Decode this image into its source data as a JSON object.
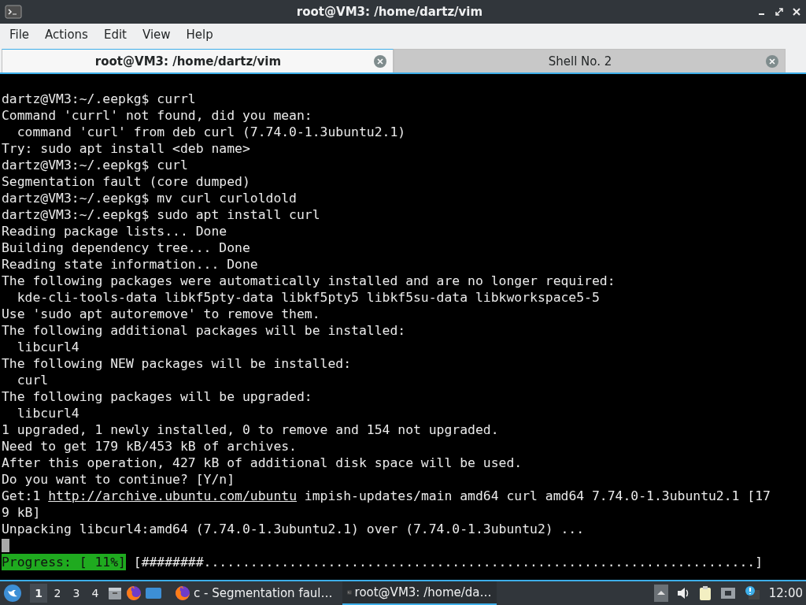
{
  "window": {
    "title": "root@VM3: /home/dartz/vim"
  },
  "menu": [
    "File",
    "Actions",
    "Edit",
    "View",
    "Help"
  ],
  "tabs": [
    {
      "label": "root@VM3: /home/dartz/vim",
      "selected": true
    },
    {
      "label": "Shell No. 2",
      "selected": false
    }
  ],
  "terminal": {
    "lines": [
      {
        "kind": "blank"
      },
      {
        "kind": "text",
        "text": "dartz@VM3:~/.eepkg$ currl"
      },
      {
        "kind": "text",
        "text": "Command 'currl' not found, did you mean:"
      },
      {
        "kind": "text",
        "text": "  command 'curl' from deb curl (7.74.0-1.3ubuntu2.1)"
      },
      {
        "kind": "text",
        "text": "Try: sudo apt install <deb name>"
      },
      {
        "kind": "text",
        "text": "dartz@VM3:~/.eepkg$ curl"
      },
      {
        "kind": "text",
        "text": "Segmentation fault (core dumped)"
      },
      {
        "kind": "text",
        "text": "dartz@VM3:~/.eepkg$ mv curl curloldold"
      },
      {
        "kind": "text",
        "text": "dartz@VM3:~/.eepkg$ sudo apt install curl"
      },
      {
        "kind": "text",
        "text": "Reading package lists... Done"
      },
      {
        "kind": "text",
        "text": "Building dependency tree... Done"
      },
      {
        "kind": "text",
        "text": "Reading state information... Done"
      },
      {
        "kind": "text",
        "text": "The following packages were automatically installed and are no longer required:"
      },
      {
        "kind": "text",
        "text": "  kde-cli-tools-data libkf5pty-data libkf5pty5 libkf5su-data libkworkspace5-5"
      },
      {
        "kind": "text",
        "text": "Use 'sudo apt autoremove' to remove them."
      },
      {
        "kind": "text",
        "text": "The following additional packages will be installed:"
      },
      {
        "kind": "text",
        "text": "  libcurl4"
      },
      {
        "kind": "text",
        "text": "The following NEW packages will be installed:"
      },
      {
        "kind": "text",
        "text": "  curl"
      },
      {
        "kind": "text",
        "text": "The following packages will be upgraded:"
      },
      {
        "kind": "text",
        "text": "  libcurl4"
      },
      {
        "kind": "text",
        "text": "1 upgraded, 1 newly installed, 0 to remove and 154 not upgraded."
      },
      {
        "kind": "text",
        "text": "Need to get 179 kB/453 kB of archives."
      },
      {
        "kind": "text",
        "text": "After this operation, 427 kB of additional disk space will be used."
      },
      {
        "kind": "text",
        "text": "Do you want to continue? [Y/n]"
      },
      {
        "kind": "link",
        "before": "Get:1 ",
        "link": "http://archive.ubuntu.com/ubuntu",
        "after": " impish-updates/main amd64 curl amd64 7.74.0-1.3ubuntu2.1 [17"
      },
      {
        "kind": "text",
        "text": "9 kB]"
      },
      {
        "kind": "text",
        "text": "Unpacking libcurl4:amd64 (7.74.0-1.3ubuntu2.1) over (7.74.0-1.3ubuntu2) ..."
      },
      {
        "kind": "cursor"
      },
      {
        "kind": "progress",
        "label": "Progress: [ 11%]",
        "bar": " [########.......................................................................]"
      }
    ]
  },
  "taskbar": {
    "workspaces": [
      {
        "label": "1",
        "selected": true
      },
      {
        "label": "2",
        "selected": false
      },
      {
        "label": "3",
        "selected": false
      },
      {
        "label": "4",
        "selected": false
      }
    ],
    "tasks": [
      {
        "kind": "browser",
        "label": "c - Segmentation faul…",
        "selected": false
      },
      {
        "kind": "terminal",
        "label": "root@VM3: /home/da…",
        "selected": true
      }
    ],
    "clock": "12:00"
  }
}
